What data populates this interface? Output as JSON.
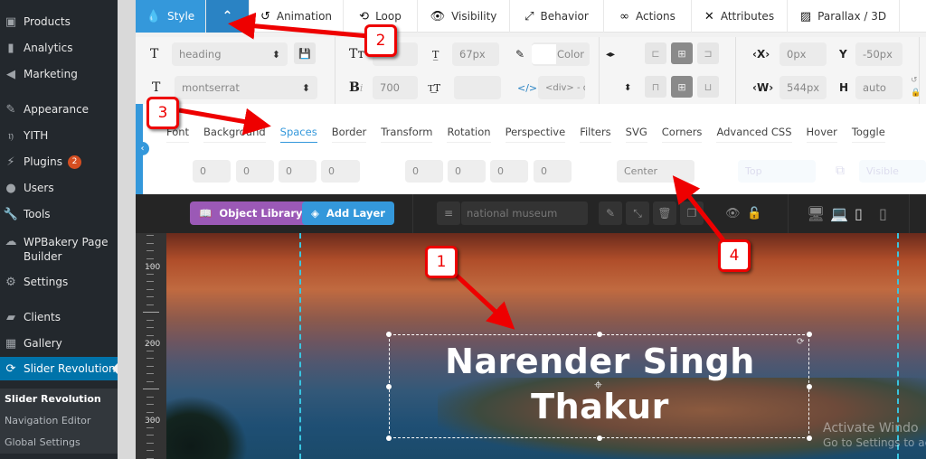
{
  "wp_sidebar": {
    "items": [
      {
        "label": "Products",
        "icon": "box-icon"
      },
      {
        "label": "Analytics",
        "icon": "bar-chart-icon"
      },
      {
        "label": "Marketing",
        "icon": "megaphone-icon"
      },
      {
        "label": "Appearance",
        "icon": "paintbrush-icon"
      },
      {
        "label": "YITH",
        "icon": "yith-icon"
      },
      {
        "label": "Plugins",
        "icon": "plug-icon",
        "badge": "2"
      },
      {
        "label": "Users",
        "icon": "user-icon"
      },
      {
        "label": "Tools",
        "icon": "wrench-icon"
      },
      {
        "label": "WPBakery Page Builder",
        "icon": "cloud-icon"
      },
      {
        "label": "Settings",
        "icon": "sliders-icon"
      },
      {
        "label": "Clients",
        "icon": "comment-icon"
      },
      {
        "label": "Gallery",
        "icon": "grid-icon"
      },
      {
        "label": "Slider Revolution",
        "icon": "refresh-icon",
        "active": true
      }
    ],
    "submenu": [
      "Slider Revolution",
      "Navigation Editor",
      "Global Settings"
    ]
  },
  "top_tabs": [
    {
      "label": "Style",
      "icon": "droplet-icon"
    },
    {
      "label": "",
      "icon": "chevron-up-icon"
    },
    {
      "label": "Animation",
      "icon": "history-icon"
    },
    {
      "label": "Loop",
      "icon": "loop-icon"
    },
    {
      "label": "Visibility",
      "icon": "eye-icon"
    },
    {
      "label": "Behavior",
      "icon": "expand-icon"
    },
    {
      "label": "Actions",
      "icon": "link-icon"
    },
    {
      "label": "Attributes",
      "icon": "tools-icon"
    },
    {
      "label": "Parallax / 3D",
      "icon": "image-icon"
    }
  ],
  "props": {
    "row1": {
      "preset": "heading",
      "font_size": "",
      "line_height": "67px",
      "color_label": "Color",
      "color_value": "#ffffff",
      "x_label": "X",
      "x_value": "0px",
      "y_label": "Y",
      "y_value": "-50px"
    },
    "row2": {
      "font_family": "montserrat",
      "font_weight": "700",
      "letter_spacing": "",
      "tag": "<div> - de",
      "w_label": "W",
      "w_value": "544px",
      "h_label": "H",
      "h_value": "auto"
    }
  },
  "style_panel": {
    "subtabs": [
      "Font",
      "Background",
      "Spaces",
      "Border",
      "Transform",
      "Rotation",
      "Perspective",
      "Filters",
      "SVG",
      "Corners",
      "Advanced CSS",
      "Hover",
      "Toggle"
    ],
    "active_subtab": "Spaces",
    "margin": [
      "0",
      "0",
      "0",
      "0"
    ],
    "padding": [
      "0",
      "0",
      "0",
      "0"
    ],
    "text_align": "Center",
    "vertical_align": "Top",
    "overflow": "Visible"
  },
  "dark_toolbar": {
    "object_library": "Object Library",
    "add_layer": "Add Layer",
    "layer_name": "national museum"
  },
  "canvas": {
    "ruler_labels": [
      "100",
      "200",
      "300"
    ],
    "heading_line1": "Narender Singh",
    "heading_line2": "Thakur",
    "watermark_line1": "Activate Windo",
    "watermark_line2": "Go to Settings to act"
  },
  "annotations": [
    "1",
    "2",
    "3",
    "4"
  ],
  "colors": {
    "accent_blue": "#3498db",
    "wp_active": "#0073aa",
    "purple": "#9b59b6",
    "annotation_red": "#ee0000",
    "guide_cyan": "#39c5e0"
  }
}
